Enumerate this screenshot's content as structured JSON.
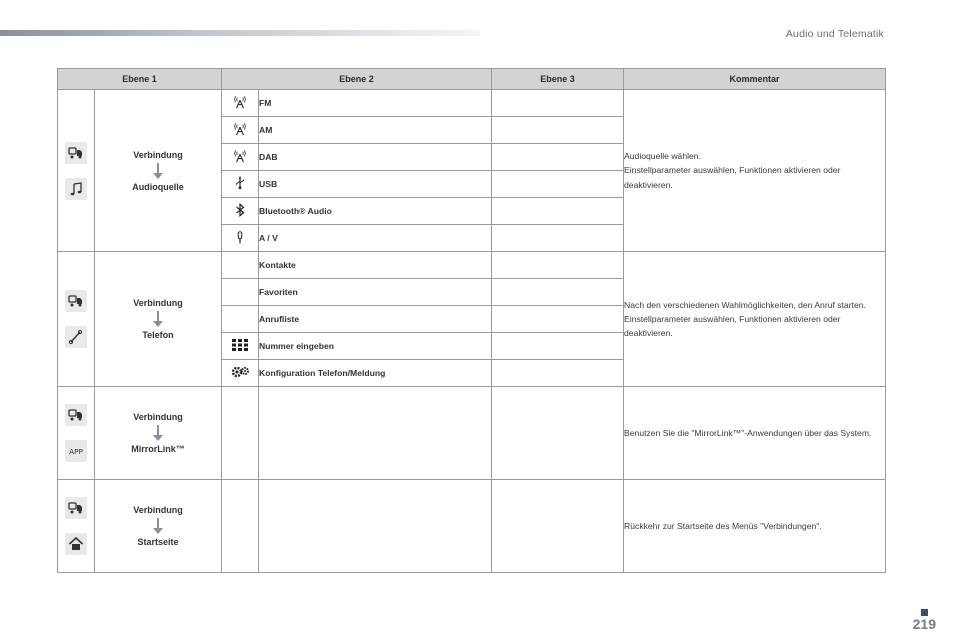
{
  "header": {
    "section_title": "Audio und Telematik"
  },
  "table": {
    "headers": [
      "Ebene 1",
      "Ebene 2",
      "Ebene 3",
      "Kommentar"
    ],
    "groups": [
      {
        "level1_top": "Verbindung",
        "level1_bottom": "Audioquelle",
        "icons": [
          "connections-icon",
          "music-note-icon"
        ],
        "rows": [
          {
            "icon": "radio-antenna-icon",
            "label": "FM"
          },
          {
            "icon": "radio-antenna-icon",
            "label": "AM"
          },
          {
            "icon": "radio-antenna-icon",
            "label": "DAB"
          },
          {
            "icon": "usb-icon",
            "label": "USB"
          },
          {
            "icon": "bluetooth-icon",
            "label": "Bluetooth® Audio"
          },
          {
            "icon": "aux-jack-icon",
            "label": "A / V"
          }
        ],
        "comment": "Audioquelle wählen.\nEinstellparameter auswählen, Funktionen aktivieren oder deaktivieren."
      },
      {
        "level1_top": "Verbindung",
        "level1_bottom": "Telefon",
        "icons": [
          "connections-icon",
          "phone-handset-icon"
        ],
        "rows": [
          {
            "icon": "",
            "label": "Kontakte"
          },
          {
            "icon": "",
            "label": "Favoriten"
          },
          {
            "icon": "",
            "label": "Anrufliste"
          },
          {
            "icon": "keypad-icon",
            "label": "Nummer eingeben"
          },
          {
            "icon": "settings-gears-icon",
            "label": "Konfiguration Telefon/Meldung"
          }
        ],
        "comment": "Nach den verschiedenen Wahlmöglichkeiten, den Anruf starten.\nEinstellparameter auswählen, Funktionen aktivieren oder deaktivieren."
      },
      {
        "level1_top": "Verbindung",
        "level1_bottom": "MirrorLink™",
        "icons": [
          "connections-icon",
          "app-icon"
        ],
        "rows": [],
        "comment": "Benutzen Sie die \"MirrorLink™\"-Anwendungen über das System."
      },
      {
        "level1_top": "Verbindung",
        "level1_bottom": "Startseite",
        "icons": [
          "connections-icon",
          "home-icon"
        ],
        "rows": [],
        "comment": "Rückkehr zur Startseite des Menüs \"Verbindungen\"."
      }
    ]
  },
  "footer": {
    "page_number": "219"
  }
}
